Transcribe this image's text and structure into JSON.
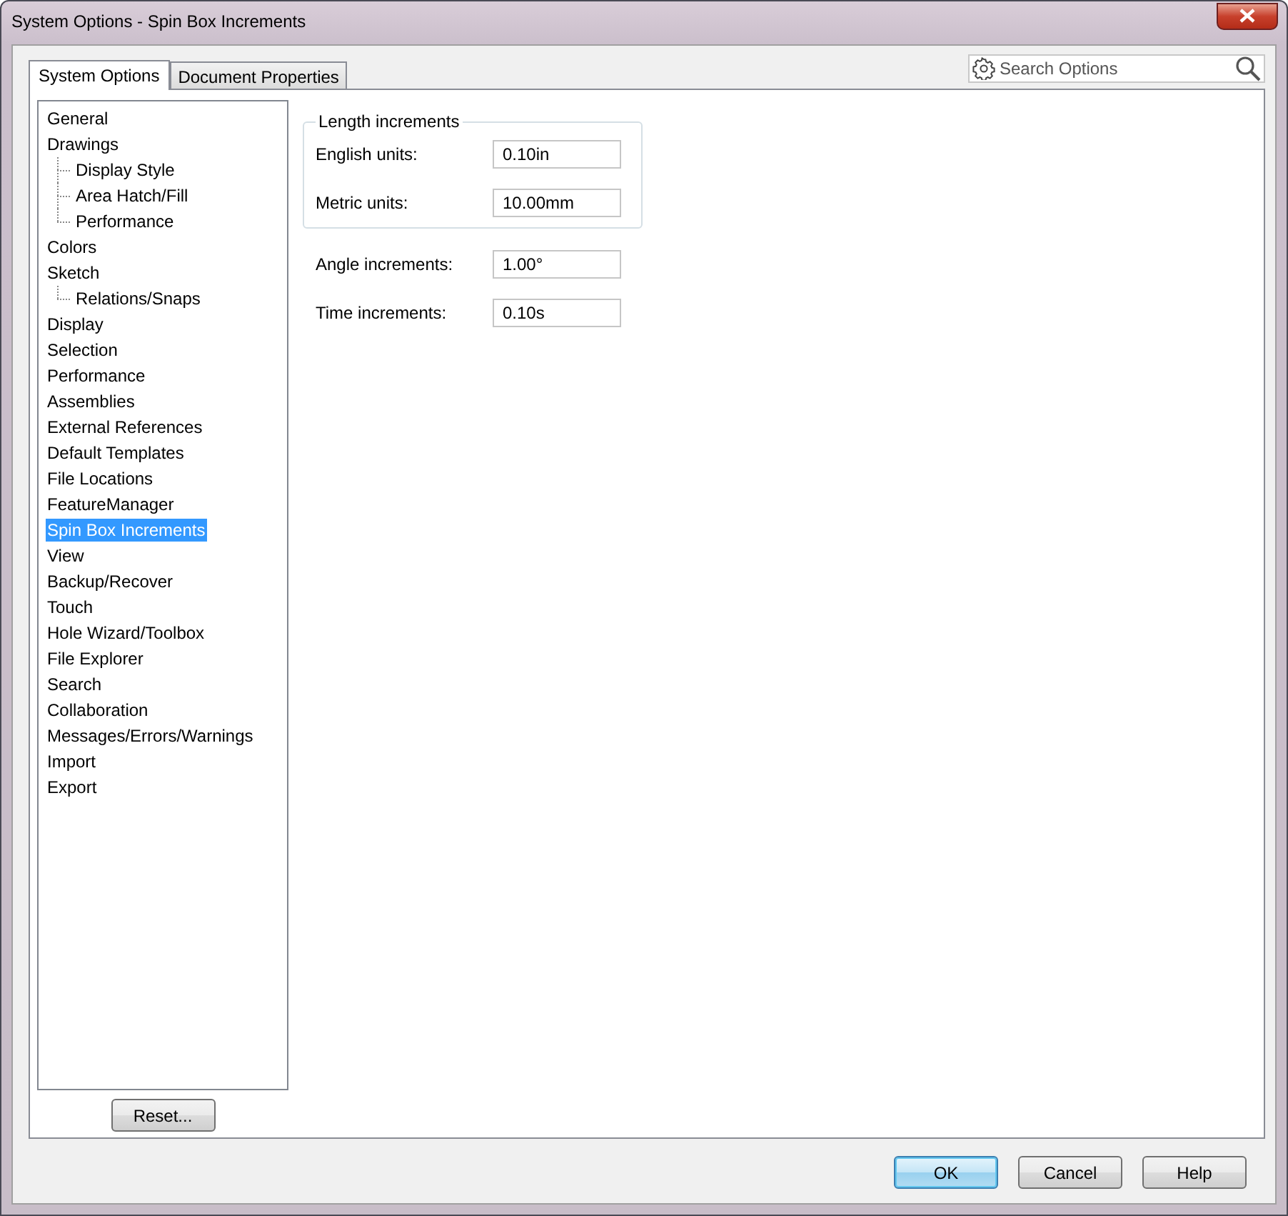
{
  "window": {
    "title": "System Options - Spin Box Increments"
  },
  "tabs": [
    {
      "label": "System Options",
      "selected": true
    },
    {
      "label": "Document Properties",
      "selected": false
    }
  ],
  "search": {
    "placeholder": "Search Options"
  },
  "tree": [
    {
      "label": "General",
      "selected": false
    },
    {
      "label": "Drawings",
      "selected": false,
      "children": [
        {
          "label": "Display Style",
          "selected": false
        },
        {
          "label": "Area Hatch/Fill",
          "selected": false
        },
        {
          "label": "Performance",
          "selected": false
        }
      ]
    },
    {
      "label": "Colors",
      "selected": false
    },
    {
      "label": "Sketch",
      "selected": false,
      "children": [
        {
          "label": "Relations/Snaps",
          "selected": false
        }
      ]
    },
    {
      "label": "Display",
      "selected": false
    },
    {
      "label": "Selection",
      "selected": false
    },
    {
      "label": "Performance",
      "selected": false
    },
    {
      "label": "Assemblies",
      "selected": false
    },
    {
      "label": "External References",
      "selected": false
    },
    {
      "label": "Default Templates",
      "selected": false
    },
    {
      "label": "File Locations",
      "selected": false
    },
    {
      "label": "FeatureManager",
      "selected": false
    },
    {
      "label": "Spin Box Increments",
      "selected": true
    },
    {
      "label": "View",
      "selected": false
    },
    {
      "label": "Backup/Recover",
      "selected": false
    },
    {
      "label": "Touch",
      "selected": false
    },
    {
      "label": "Hole Wizard/Toolbox",
      "selected": false
    },
    {
      "label": "File Explorer",
      "selected": false
    },
    {
      "label": "Search",
      "selected": false
    },
    {
      "label": "Collaboration",
      "selected": false
    },
    {
      "label": "Messages/Errors/Warnings",
      "selected": false
    },
    {
      "label": "Import",
      "selected": false
    },
    {
      "label": "Export",
      "selected": false
    }
  ],
  "reset_button": "Reset...",
  "length_group": {
    "title": "Length increments",
    "fields": [
      {
        "label": "English units:",
        "value": "0.10in"
      },
      {
        "label": "Metric units:",
        "value": "10.00mm"
      }
    ]
  },
  "fields": [
    {
      "label": "Angle increments:",
      "value": "1.00°"
    },
    {
      "label": "Time increments:",
      "value": "0.10s"
    }
  ],
  "buttons": [
    {
      "label": "OK",
      "selected": true
    },
    {
      "label": "Cancel",
      "selected": false
    },
    {
      "label": "Help",
      "selected": false
    }
  ]
}
